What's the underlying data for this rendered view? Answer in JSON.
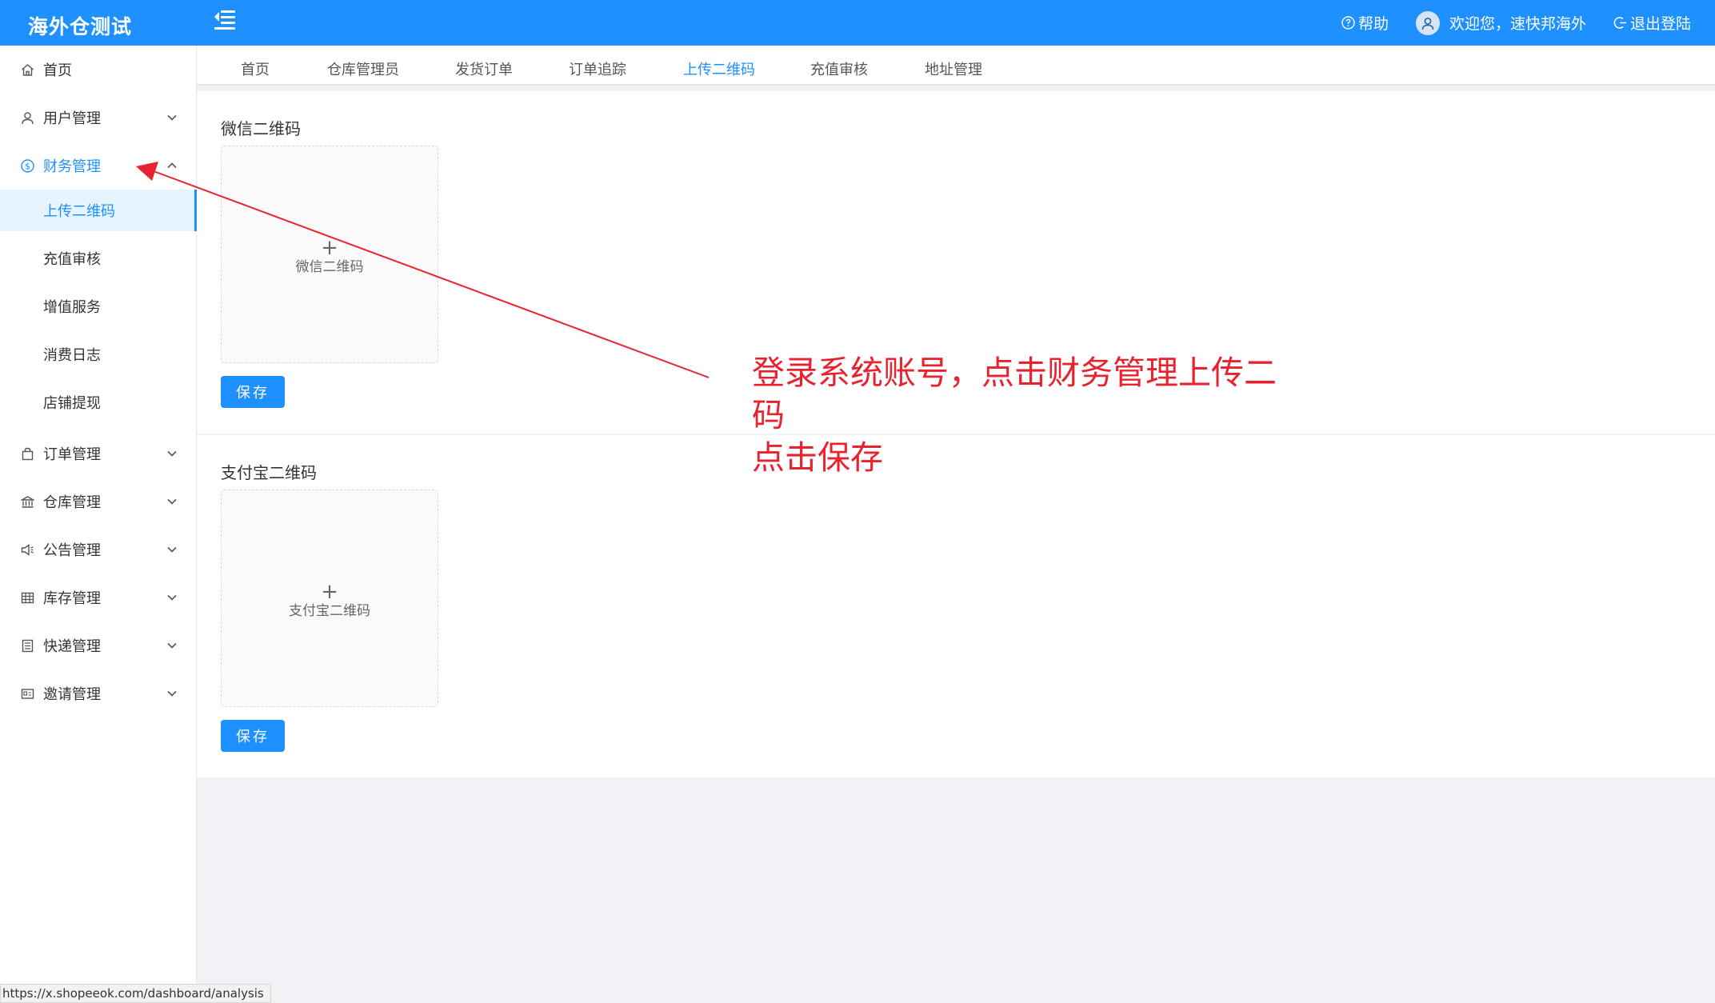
{
  "header": {
    "brand": "海外仓测试",
    "help": "帮助",
    "welcome": "欢迎您，速快邦海外",
    "logout": "退出登陆"
  },
  "sidebar": {
    "items": [
      {
        "label": "首页",
        "icon": "home-icon"
      },
      {
        "label": "用户管理",
        "icon": "user-icon"
      },
      {
        "label": "财务管理",
        "icon": "dollar-icon"
      },
      {
        "label": "订单管理",
        "icon": "bag-icon"
      },
      {
        "label": "仓库管理",
        "icon": "bank-icon"
      },
      {
        "label": "公告管理",
        "icon": "sound-icon"
      },
      {
        "label": "库存管理",
        "icon": "table-icon"
      },
      {
        "label": "快递管理",
        "icon": "list-icon"
      },
      {
        "label": "邀请管理",
        "icon": "id-card-icon"
      }
    ],
    "finance_sub": [
      "上传二维码",
      "充值审核",
      "增值服务",
      "消费日志",
      "店铺提现"
    ]
  },
  "tabs": [
    "首页",
    "仓库管理员",
    "发货订单",
    "订单追踪",
    "上传二维码",
    "充值审核",
    "地址管理"
  ],
  "wechat": {
    "title": "微信二维码",
    "upload_plus": "+",
    "upload_label": "微信二维码",
    "save": "保存"
  },
  "alipay": {
    "title": "支付宝二维码",
    "upload_plus": "+",
    "upload_label": "支付宝二维码",
    "save": "保存"
  },
  "annotation": {
    "line1": "登录系统账号，点击财务管理上传二码",
    "line2": "点击保存",
    "color": "#e8232f"
  },
  "status_bar": {
    "url": "https://x.shopeeok.com/dashboard/analysis"
  },
  "colors": {
    "primary": "#1e90ff",
    "active_bg": "#e6f4ff"
  }
}
